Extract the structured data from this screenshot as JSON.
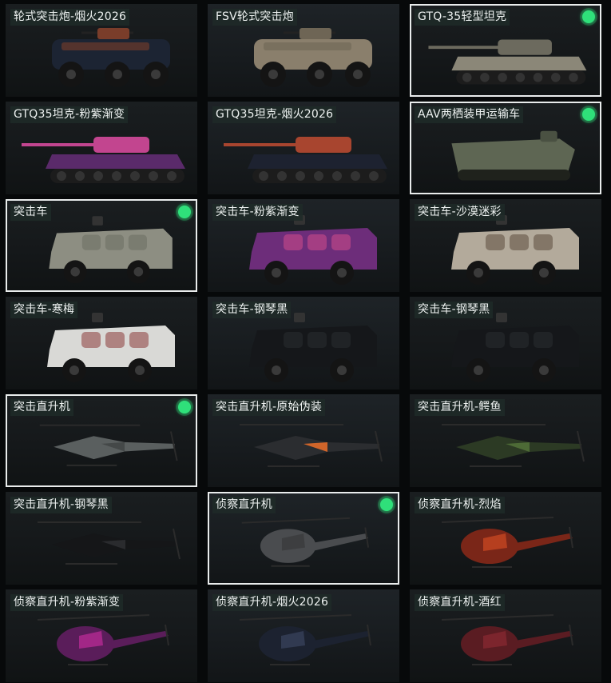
{
  "status_color": "#2fe07a",
  "items": [
    {
      "label": "轮式突击炮-烟火2026",
      "kind": "wheeled-gun",
      "body": "#1c2433",
      "accent": "#7a3d2a",
      "selected": false,
      "equipped": false
    },
    {
      "label": "FSV轮式突击炮",
      "kind": "wheeled-gun",
      "body": "#8a7f6c",
      "accent": "#6e6555",
      "selected": false,
      "equipped": false
    },
    {
      "label": "GTQ-35轻型坦克",
      "kind": "tank",
      "body": "#8b8778",
      "accent": "#6c6a5e",
      "selected": true,
      "equipped": true
    },
    {
      "label": "GTQ35坦克-粉紫渐变",
      "kind": "tank",
      "body": "#5a2a6a",
      "accent": "#c2458f",
      "selected": false,
      "equipped": false
    },
    {
      "label": "GTQ35坦克-烟火2026",
      "kind": "tank",
      "body": "#1d2230",
      "accent": "#a8452f",
      "selected": false,
      "equipped": false
    },
    {
      "label": "AAV两栖装甲运输车",
      "kind": "amphibious",
      "body": "#5e6653",
      "accent": "#4a5142",
      "selected": true,
      "equipped": true
    },
    {
      "label": "突击车",
      "kind": "truck",
      "body": "#8d8e82",
      "accent": "#6c6d63",
      "selected": true,
      "equipped": true
    },
    {
      "label": "突击车-粉紫渐变",
      "kind": "truck",
      "body": "#6d2d7a",
      "accent": "#d24c8a",
      "selected": false,
      "equipped": false
    },
    {
      "label": "突击车-沙漠迷彩",
      "kind": "truck",
      "body": "#b3aa9b",
      "accent": "#5b4a3c",
      "selected": false,
      "equipped": false
    },
    {
      "label": "突击车-寒梅",
      "kind": "truck",
      "body": "#d9d9d6",
      "accent": "#8a3b3b",
      "selected": false,
      "equipped": false
    },
    {
      "label": "突击车-钢琴黑",
      "kind": "truck",
      "body": "#15171a",
      "accent": "#2a2d31",
      "selected": false,
      "equipped": false
    },
    {
      "label": "突击车-钢琴黑",
      "kind": "truck",
      "body": "#15171a",
      "accent": "#2a2d31",
      "selected": false,
      "equipped": false
    },
    {
      "label": "突击直升机",
      "kind": "attack-heli",
      "body": "#5a5f5f",
      "accent": "#444848",
      "selected": true,
      "equipped": true
    },
    {
      "label": "突击直升机-原始伪装",
      "kind": "attack-heli",
      "body": "#2b2d30",
      "accent": "#d0652a",
      "selected": false,
      "equipped": false
    },
    {
      "label": "突击直升机-鳄鱼",
      "kind": "attack-heli",
      "body": "#2c3a24",
      "accent": "#4d6a36",
      "selected": false,
      "equipped": false
    },
    {
      "label": "突击直升机-钢琴黑",
      "kind": "attack-heli",
      "body": "#151618",
      "accent": "#2a2b2e",
      "selected": false,
      "equipped": false
    },
    {
      "label": "侦察直升机",
      "kind": "scout-heli",
      "body": "#4a4c4f",
      "accent": "#37393b",
      "selected": true,
      "equipped": true
    },
    {
      "label": "侦察直升机-烈焰",
      "kind": "scout-heli",
      "body": "#7a2618",
      "accent": "#d04a22",
      "selected": false,
      "equipped": false
    },
    {
      "label": "侦察直升机-粉紫渐变",
      "kind": "scout-heli",
      "body": "#5a1d5a",
      "accent": "#c02c9a",
      "selected": false,
      "equipped": false
    },
    {
      "label": "侦察直升机-烟火2026",
      "kind": "scout-heli",
      "body": "#1c2230",
      "accent": "#3a4560",
      "selected": false,
      "equipped": false
    },
    {
      "label": "侦察直升机-酒红",
      "kind": "scout-heli",
      "body": "#5a1c22",
      "accent": "#8a2a32",
      "selected": false,
      "equipped": false
    }
  ]
}
